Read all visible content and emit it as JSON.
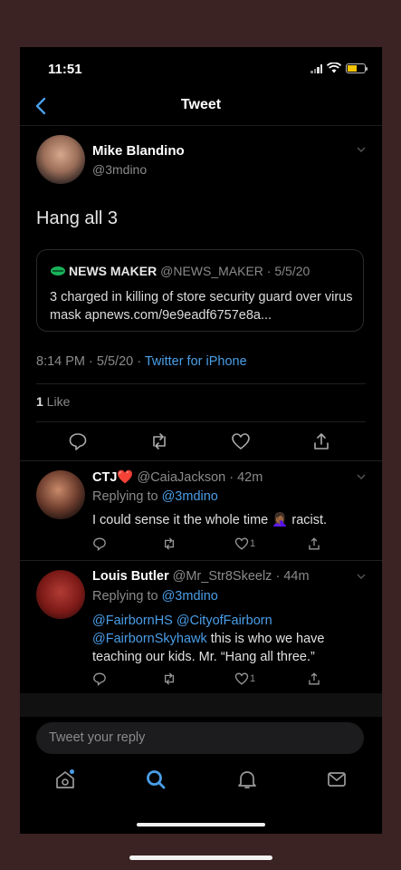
{
  "status": {
    "time": "11:51",
    "battery_level": 0.5
  },
  "nav": {
    "title": "Tweet"
  },
  "tweet": {
    "author_name": "Mike Blandino",
    "author_handle": "@3mdino",
    "text": "Hang all 3",
    "quote": {
      "name": "NEWS MAKER",
      "meta": "@NEWS_MAKER · 5/5/20",
      "body": "3 charged in killing of store security guard over virus mask apnews.com/9e9eadf6757e8a..."
    },
    "time": "8:14 PM · 5/5/20 · ",
    "source": "Twitter for iPhone",
    "like_count": "1",
    "like_label": " Like"
  },
  "replies": [
    {
      "name": "CTJ❤️",
      "handle": "@CaiaJackson · 42m",
      "replying_prefix": "Replying to ",
      "replying_to": "@3mdino",
      "text_a": "I could sense it the whole time ",
      "emoji": "🤦🏾‍♀️",
      "text_b": " racist.",
      "like_count": "1"
    },
    {
      "name": "Louis Butler",
      "handle": "@Mr_Str8Skeelz · 44m",
      "replying_prefix": "Replying to ",
      "replying_to": "@3mdino",
      "mentions_a": "@FairbornHS @CityofFairborn",
      "mentions_b": "@FairbornSkyhawk",
      "text": " this is who we have teaching our kids. Mr. “Hang all three.”",
      "like_count": "1"
    }
  ],
  "composer": {
    "placeholder": "Tweet your reply"
  },
  "colors": {
    "accent": "#4a9ee8",
    "background": "#000000",
    "like_heart": "#e0245e"
  },
  "tabs": [
    "home-icon",
    "search-icon",
    "notifications-icon",
    "messages-icon"
  ]
}
